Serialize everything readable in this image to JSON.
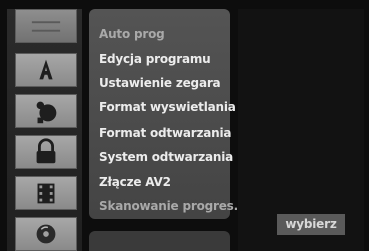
{
  "menu": {
    "items": [
      {
        "label": "Auto prog",
        "state": "dim"
      },
      {
        "label": "Edycja programu",
        "state": "normal"
      },
      {
        "label": "Ustawienie zegara",
        "state": "normal"
      },
      {
        "label": "Format wyswietlania",
        "state": "normal"
      },
      {
        "label": "Format odtwarzania",
        "state": "normal"
      },
      {
        "label": "System odtwarzania",
        "state": "normal"
      },
      {
        "label": "Złącze AV2",
        "state": "normal"
      },
      {
        "label": "Skanowanie progres.",
        "state": "dim"
      }
    ]
  },
  "sidebar": {
    "icons": [
      {
        "name": "general-settings-icon",
        "active": true
      },
      {
        "name": "language-icon",
        "active": false
      },
      {
        "name": "audio-icon",
        "active": false
      },
      {
        "name": "lock-icon",
        "active": false
      },
      {
        "name": "recording-film-icon",
        "active": false
      },
      {
        "name": "disc-icon",
        "active": false
      }
    ]
  },
  "footer": {
    "select_label": "wybierz"
  },
  "colors": {
    "background": "#0d0d0d",
    "menu_panel": "#4c4c4c",
    "text": "#ececec",
    "text_dim": "#a9a9a9",
    "icon_tile": "#999999"
  }
}
